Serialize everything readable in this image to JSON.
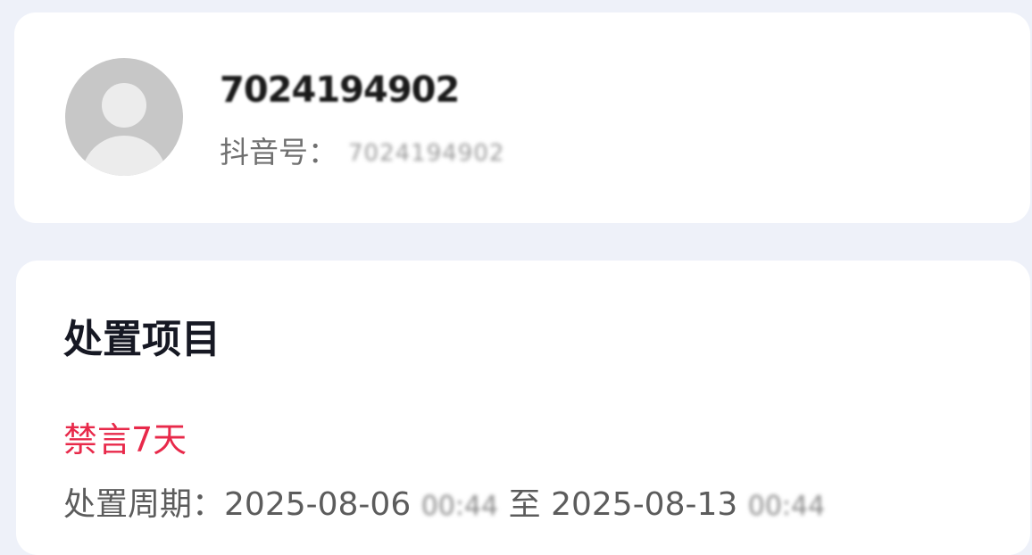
{
  "profile": {
    "nickname": "7024194902",
    "douyin_id_label": "抖音号：",
    "douyin_id_value": "7024194902"
  },
  "penalty": {
    "section_title": "处置项目",
    "penalty_name": "禁言7天",
    "period_label": "处置周期：",
    "start_date": "2025-08-06",
    "start_time": "00:44",
    "separator": "至",
    "end_date": "2025-08-13",
    "end_time": "00:44"
  },
  "colors": {
    "page_background": "#eef1f9",
    "card_background": "#ffffff",
    "penalty_red": "#e8294a",
    "title_text": "#161823",
    "secondary_text": "#5c5c5c"
  },
  "icons": {
    "avatar": "default-user-avatar",
    "left_chevron": "chevron-left-icon"
  }
}
